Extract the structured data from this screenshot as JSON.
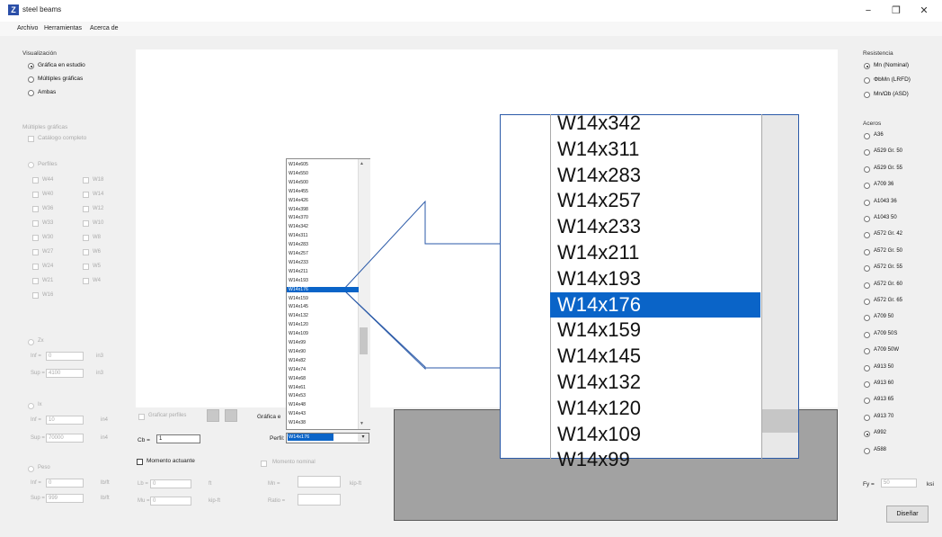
{
  "window": {
    "title": "steel beams",
    "app_icon": "Z",
    "minimize": "−",
    "maximize": "❐",
    "close": "✕"
  },
  "menu": [
    "Archivo",
    "Herramientas",
    "Acerca de"
  ],
  "left": {
    "visualizacion": {
      "title": "Visualización",
      "options": [
        "Gráfica en estudio",
        "Múltiples gráficas",
        "Ambas"
      ],
      "selected": 0
    },
    "multiples": {
      "title": "Múltiples gráficas",
      "catalogo": "Catálogo completo",
      "perfiles": "Perfiles",
      "items": [
        "W44",
        "W18",
        "W40",
        "W14",
        "W36",
        "W12",
        "W33",
        "W10",
        "W30",
        "W8",
        "W27",
        "W6",
        "W24",
        "W5",
        "W21",
        "W4",
        "W16"
      ]
    },
    "zx": {
      "label": "Zx",
      "inf_label": "Inf =",
      "inf_value": "0",
      "inf_unit": "in3",
      "sup_label": "Sup =",
      "sup_value": "4100",
      "sup_unit": "in3"
    },
    "ix": {
      "label": "Ix",
      "inf_label": "Inf =",
      "inf_value": "10",
      "inf_unit": "in4",
      "sup_label": "Sup =",
      "sup_value": "70000",
      "sup_unit": "in4"
    },
    "peso": {
      "label": "Peso",
      "inf_label": "Inf =",
      "inf_value": "0",
      "inf_unit": "lb/ft",
      "sup_label": "Sup =",
      "sup_value": "999",
      "sup_unit": "lb/ft"
    }
  },
  "bottom": {
    "graficas_label": "Graficar perfiles",
    "cb_label": "Cb =",
    "cb_value": "1",
    "momento_actuante": "Momento actuante",
    "lb_label": "Lb =",
    "lb_value": "0",
    "lb_unit": "ft",
    "mu_label": "Mu =",
    "mu_value": "0",
    "mu_unit": "kip-ft",
    "grafica_label": "Gráfica e",
    "perfil_label": "Perfil:",
    "perfil_value": "W14x176",
    "momento_nominal": "Momento nominal",
    "mn_label": "Mn =",
    "mn_unit": "kip-ft",
    "ratio_label": "Ratio ="
  },
  "small_list": [
    "W14x605",
    "W14x550",
    "W14x500",
    "W14x455",
    "W14x426",
    "W14x398",
    "W14x370",
    "W14x342",
    "W14x311",
    "W14x283",
    "W14x257",
    "W14x233",
    "W14x211",
    "W14x193",
    "W14x176",
    "W14x159",
    "W14x145",
    "W14x132",
    "W14x120",
    "W14x109",
    "W14x99",
    "W14x90",
    "W14x82",
    "W14x74",
    "W14x68",
    "W14x61",
    "W14x53",
    "W14x48",
    "W14x43",
    "W14x38"
  ],
  "small_selected": 14,
  "zoom_list": [
    "W14x342",
    "W14x311",
    "W14x283",
    "W14x257",
    "W14x233",
    "W14x211",
    "W14x193",
    "W14x176",
    "W14x159",
    "W14x145",
    "W14x132",
    "W14x120",
    "W14x109",
    "W14x99"
  ],
  "zoom_selected": 7,
  "right": {
    "resistencia": {
      "title": "Resistencia",
      "options": [
        "Mn (Nominal)",
        "ΦbMn (LRFD)",
        "Mn/Ωb (ASD)"
      ],
      "selected": 0
    },
    "aceros": {
      "title": "Aceros",
      "options": [
        "A36",
        "A529 Gr. 50",
        "A529 Gr. 55",
        "A709 36",
        "A1043 36",
        "A1043 50",
        "A572 Gr. 42",
        "A572 Gr. 50",
        "A572 Gr. 55",
        "A572 Gr. 60",
        "A572 Gr. 65",
        "A709 50",
        "A709 50S",
        "A709 50W",
        "A913 50",
        "A913 60",
        "A913 65",
        "A913 70",
        "A992",
        "A588"
      ],
      "selected": 18
    },
    "fy_label": "Fy =",
    "fy_value": "50",
    "fy_unit": "ksi",
    "disenar": "Diseñar"
  }
}
